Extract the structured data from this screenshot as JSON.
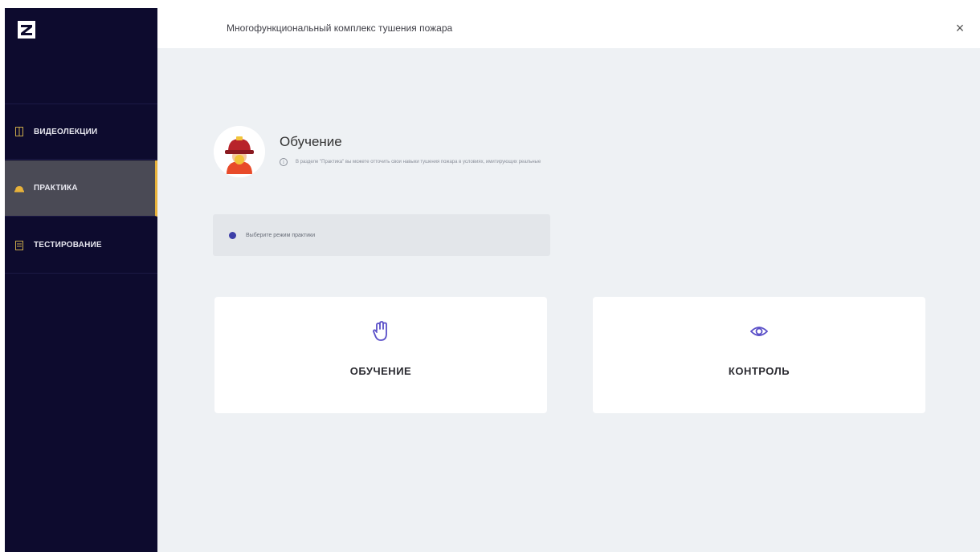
{
  "app": {
    "title": "Многофункциональный комплекс тушения пожара",
    "logo": "Z"
  },
  "sidebar": {
    "items": [
      {
        "label": "ВИДЕОЛЕКЦИИ",
        "icon": "video-icon",
        "active": false
      },
      {
        "label": "ПРАКТИКА",
        "icon": "helmet-icon",
        "active": true
      },
      {
        "label": "ТЕСТИРОВАНИЕ",
        "icon": "test-icon",
        "active": false
      }
    ]
  },
  "section": {
    "title": "Обучение",
    "description": "В разделе \"Практика\" вы можете отточить свои навыки тушения пожара в условиях, имитирующих реальные",
    "info_icon": "info-icon"
  },
  "hint": {
    "text": "Выберите режим практики"
  },
  "modes": [
    {
      "label": "ОБУЧЕНИЕ",
      "icon": "hand-icon"
    },
    {
      "label": "КОНТРОЛЬ",
      "icon": "eye-icon"
    }
  ],
  "colors": {
    "sidebar_bg": "#0d0b2e",
    "active_bg": "#4a4a55",
    "accent": "#e8b23a",
    "icon_purple": "#5a4fc8"
  }
}
